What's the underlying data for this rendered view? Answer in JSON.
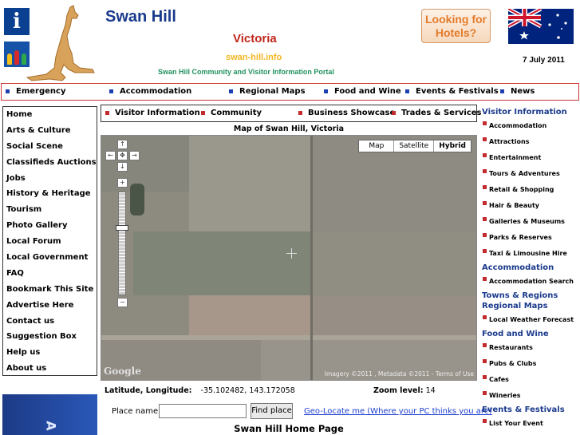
{
  "header": {
    "site_title": "Swan Hill",
    "state": "Victoria",
    "domain": "swan-hill.info",
    "portal": "Swan Hill Community and Visitor Information Portal",
    "hotels_line1": "Looking for",
    "hotels_line2": "Hotels?",
    "date": "7 July 2011"
  },
  "top_nav": [
    "Emergency",
    "Accommodation",
    "Regional Maps",
    "Food and Wine",
    "Events & Festivals",
    "News"
  ],
  "left_nav": [
    "Home",
    "Arts & Culture",
    "Social Scene",
    "Classifieds Auctions",
    "Jobs",
    "History & Heritage",
    "Tourism",
    "Photo Gallery",
    "Local Forum",
    "Local Government",
    "FAQ",
    "Bookmark This Site",
    "Advertise Here",
    "Contact us",
    "Suggestion Box",
    "Help us",
    "About us"
  ],
  "sub_nav": [
    "Visitor Information",
    "Community",
    "Business Showcase",
    "Trades & Services"
  ],
  "map": {
    "title": "Map of Swan Hill, Victoria",
    "types": [
      "Map",
      "Satellite",
      "Hybrid"
    ],
    "selected_type": "Hybrid",
    "google": "Google",
    "copyright": "Imagery ©2011 , Metadata ©2011 - Terms of Use",
    "lat_lon_label": "Latitude, Longitude:",
    "lat_lon_value": "-35.102482, 143.172058",
    "zoom_label": "Zoom level:",
    "zoom_value": "14",
    "place_label": "Place name:",
    "place_value": "",
    "find_label": "Find place",
    "geo_link": "Geo-Locate me (Where your PC thinks you are)"
  },
  "home_title": "Swan Hill Home Page",
  "left_ad_text": "A",
  "right_nav": [
    {
      "type": "h",
      "label": "Visitor Information"
    },
    {
      "type": "l",
      "label": "Accommodation"
    },
    {
      "type": "l",
      "label": "Attractions"
    },
    {
      "type": "l",
      "label": "Entertainment"
    },
    {
      "type": "l",
      "label": "Tours & Adventures"
    },
    {
      "type": "l",
      "label": "Retail & Shopping"
    },
    {
      "type": "l",
      "label": "Hair & Beauty"
    },
    {
      "type": "l",
      "label": "Galleries & Museums"
    },
    {
      "type": "l",
      "label": "Parks & Reserves"
    },
    {
      "type": "l",
      "label": "Taxi & Limousine Hire"
    },
    {
      "type": "h",
      "label": "Accommodation"
    },
    {
      "type": "l",
      "label": "Accommodation Search"
    },
    {
      "type": "h",
      "label": "Towns & Regions"
    },
    {
      "type": "h",
      "label": "Regional Maps"
    },
    {
      "type": "l",
      "label": "Local Weather Forecast"
    },
    {
      "type": "h",
      "label": "Food and Wine"
    },
    {
      "type": "l",
      "label": "Restaurants"
    },
    {
      "type": "l",
      "label": "Pubs & Clubs"
    },
    {
      "type": "l",
      "label": "Cafes"
    },
    {
      "type": "l",
      "label": "Wineries"
    },
    {
      "type": "h",
      "label": "Events & Festivals"
    },
    {
      "type": "l",
      "label": "List Your Event"
    }
  ]
}
